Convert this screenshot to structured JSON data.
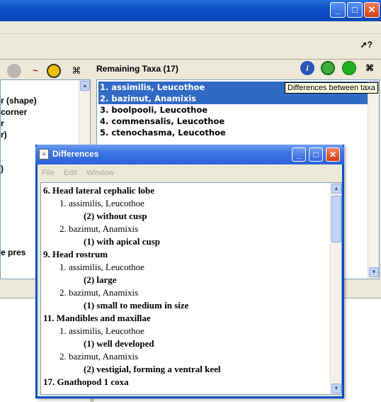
{
  "main_window": {
    "minimize": "_",
    "maximize": "□",
    "close": "✕",
    "help_label": "?"
  },
  "left_panel": {
    "items": [
      "r (shape)",
      "corner",
      "r",
      "r)",
      ")",
      "e pres"
    ]
  },
  "remaining_taxa": {
    "title": "Remaining Taxa (17)",
    "items": [
      "1. assimilis, Leucothoe",
      "2. bazimut, Anamixis",
      "3. boolpooli, Leucothoe",
      "4. commensalis, Leucothoe",
      "5. ctenochasma, Leucothoe"
    ],
    "selected": [
      0,
      1
    ]
  },
  "tooltip": "Differences between taxa",
  "differences_window": {
    "title": "Differences",
    "menu": [
      "File",
      "Edit",
      "Window"
    ],
    "lines": [
      {
        "type": "char",
        "text": "6. Head lateral cephalic lobe"
      },
      {
        "type": "taxon",
        "text": "1. assimilis, Leucothoe"
      },
      {
        "type": "state",
        "text": "(2) without cusp"
      },
      {
        "type": "taxon",
        "text": "2. bazimut, Anamixis"
      },
      {
        "type": "state",
        "text": "(1) with apical cusp"
      },
      {
        "type": "char",
        "text": "9. Head rostrum"
      },
      {
        "type": "taxon",
        "text": "1. assimilis, Leucothoe"
      },
      {
        "type": "state",
        "text": "(2) large"
      },
      {
        "type": "taxon",
        "text": "2. bazimut, Anamixis"
      },
      {
        "type": "state",
        "text": "(1) small to medium in size"
      },
      {
        "type": "char",
        "text": "11. Mandibles and maxillae"
      },
      {
        "type": "taxon",
        "text": "1. assimilis, Leucothoe"
      },
      {
        "type": "state",
        "text": "(1) well developed"
      },
      {
        "type": "taxon",
        "text": "2. bazimut, Anamixis"
      },
      {
        "type": "state",
        "text": "(2) vestigial, forming a ventral keel"
      },
      {
        "type": "char",
        "text": "17. Gnathopod 1 coxa"
      }
    ]
  }
}
